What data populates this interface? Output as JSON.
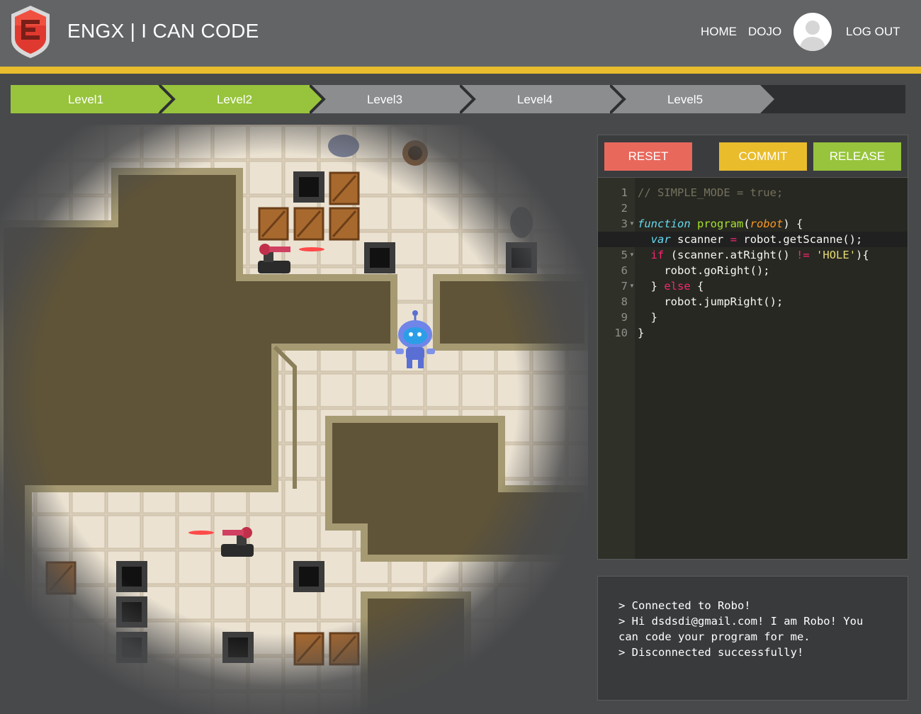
{
  "header": {
    "title": "ENGX | I CAN CODE",
    "nav": {
      "home": "HOME",
      "dojo": "DOJO",
      "logout": "LOG OUT"
    }
  },
  "levels": [
    {
      "label": "Level1",
      "state": "completed"
    },
    {
      "label": "Level2",
      "state": "completed"
    },
    {
      "label": "Level3",
      "state": "locked"
    },
    {
      "label": "Level4",
      "state": "locked"
    },
    {
      "label": "Level5",
      "state": "locked"
    }
  ],
  "editor": {
    "buttons": {
      "reset": "RESET",
      "commit": "COMMIT",
      "release": "RELEASE"
    },
    "line_numbers": [
      "1",
      "2",
      "3",
      "4",
      "5",
      "6",
      "7",
      "8",
      "9",
      "10"
    ],
    "code": {
      "l1": "// SIMPLE_MODE = true;",
      "l3_kw": "function",
      "l3_fn": "program",
      "l3_param": "robot",
      "l4_kw": "var",
      "l4_rest": "scanner",
      "l4_op": "=",
      "l4_call": "robot.getScanne();",
      "l5_kw": "if",
      "l5_cond": "(scanner.atRight()",
      "l5_op": "!=",
      "l5_str": "'HOLE'",
      "l5_end": "){",
      "l6": "robot.goRight();",
      "l7_kw": "else",
      "l8": "robot.jumpRight();",
      "l9": "}",
      "l10": "}"
    }
  },
  "console": {
    "lines": [
      "> Connected to Robo!",
      "> Hi dsdsdi@gmail.com! I am Robo! You",
      "can code your program for me.",
      "> Disconnected successfully!"
    ]
  },
  "colors": {
    "header_bg": "#636466",
    "accent_bar": "#e8bc2c",
    "level_done": "#97c43c",
    "level_locked": "#8c8d8f",
    "reset": "#e9685c",
    "commit": "#e9bc2c",
    "release": "#97c43c"
  },
  "icons": [
    "engx-logo-icon",
    "user-avatar-icon",
    "robot-icon",
    "turret-icon",
    "crate-icon",
    "hole-icon",
    "portal-icon"
  ]
}
